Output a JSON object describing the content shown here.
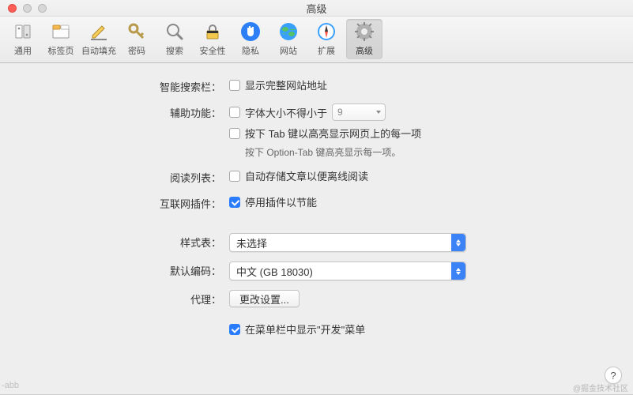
{
  "window": {
    "title": "高级"
  },
  "toolbar": {
    "items": [
      {
        "label": "通用"
      },
      {
        "label": "标签页"
      },
      {
        "label": "自动填充"
      },
      {
        "label": "密码"
      },
      {
        "label": "搜索"
      },
      {
        "label": "安全性"
      },
      {
        "label": "隐私"
      },
      {
        "label": "网站"
      },
      {
        "label": "扩展"
      },
      {
        "label": "高级"
      }
    ]
  },
  "form": {
    "smart_search": {
      "label": "智能搜索栏：",
      "option1": "显示完整网站地址",
      "checked1": false
    },
    "accessibility": {
      "label": "辅助功能：",
      "option1": "字体大小不得小于",
      "font_value": "9",
      "checked1": false,
      "option2": "按下 Tab 键以高亮显示网页上的每一项",
      "checked2": false,
      "hint": "按下 Option-Tab 键高亮显示每一项。"
    },
    "reading_list": {
      "label": "阅读列表：",
      "option1": "自动存储文章以便离线阅读",
      "checked1": false
    },
    "plugins": {
      "label": "互联网插件：",
      "option1": "停用插件以节能",
      "checked1": true
    },
    "stylesheet": {
      "label": "样式表：",
      "value": "未选择"
    },
    "encoding": {
      "label": "默认编码：",
      "value": "中文 (GB 18030)"
    },
    "proxy": {
      "label": "代理：",
      "button": "更改设置..."
    },
    "dev_menu": {
      "option1": "在菜单栏中显示\"开发\"菜单",
      "checked1": true
    }
  },
  "misc": {
    "help": "?",
    "watermark": "@掘金技术社区",
    "bg_text": "-abb"
  }
}
